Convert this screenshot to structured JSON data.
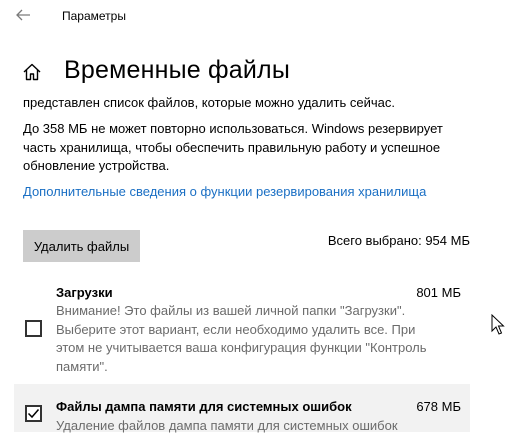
{
  "window": {
    "title": "Параметры"
  },
  "page": {
    "title": "Временные файлы"
  },
  "description": {
    "line1": "представлен список файлов, которые можно удалить сейчас.",
    "paragraph": "До 358 МБ не может повторно использоваться. Windows резервирует часть хранилища, чтобы обеспечить правильную работу и успешное обновление устройства.",
    "link": "Дополнительные сведения о функции резервирования хранилища"
  },
  "actions": {
    "delete_label": "Удалить файлы",
    "total_selected": "Всего выбрано: 954 МБ"
  },
  "items": [
    {
      "name": "Загрузки",
      "size": "801 МБ",
      "checked": false,
      "description": "Внимание! Это файлы из вашей личной папки \"Загрузки\". Выберите этот вариант, если необходимо удалить все. При этом не учитывается ваша конфигурация функции \"Контроль памяти\"."
    },
    {
      "name": "Файлы дампа памяти для системных ошибок",
      "size": "678 МБ",
      "checked": true,
      "description": "Удаление файлов дампа памяти для системных ошибок"
    }
  ],
  "icons": {
    "back": "back-arrow-icon",
    "home": "home-icon",
    "checkmark": "checkmark-icon",
    "cursor": "mouse-cursor-icon"
  },
  "colors": {
    "link": "#1a6fc4",
    "button_bg": "#cccccc",
    "selected_row_bg": "#f2f2f2",
    "secondary_text": "#6b6b6b"
  }
}
